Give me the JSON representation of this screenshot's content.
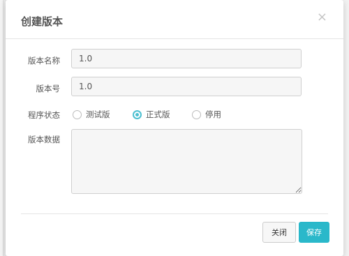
{
  "dialog": {
    "title": "创建版本",
    "close_symbol": "×"
  },
  "form": {
    "name_label": "版本名称",
    "name_value": "1.0",
    "number_label": "版本号",
    "number_value": "1.0",
    "status_label": "程序状态",
    "status_options": [
      "测试版",
      "正式版",
      "停用"
    ],
    "status_selected": "正式版",
    "data_label": "版本数据",
    "data_value": ""
  },
  "footer": {
    "close_label": "关闭",
    "save_label": "保存"
  },
  "colors": {
    "accent": "#2ab8ca",
    "radio_active": "#4bbfd0"
  }
}
